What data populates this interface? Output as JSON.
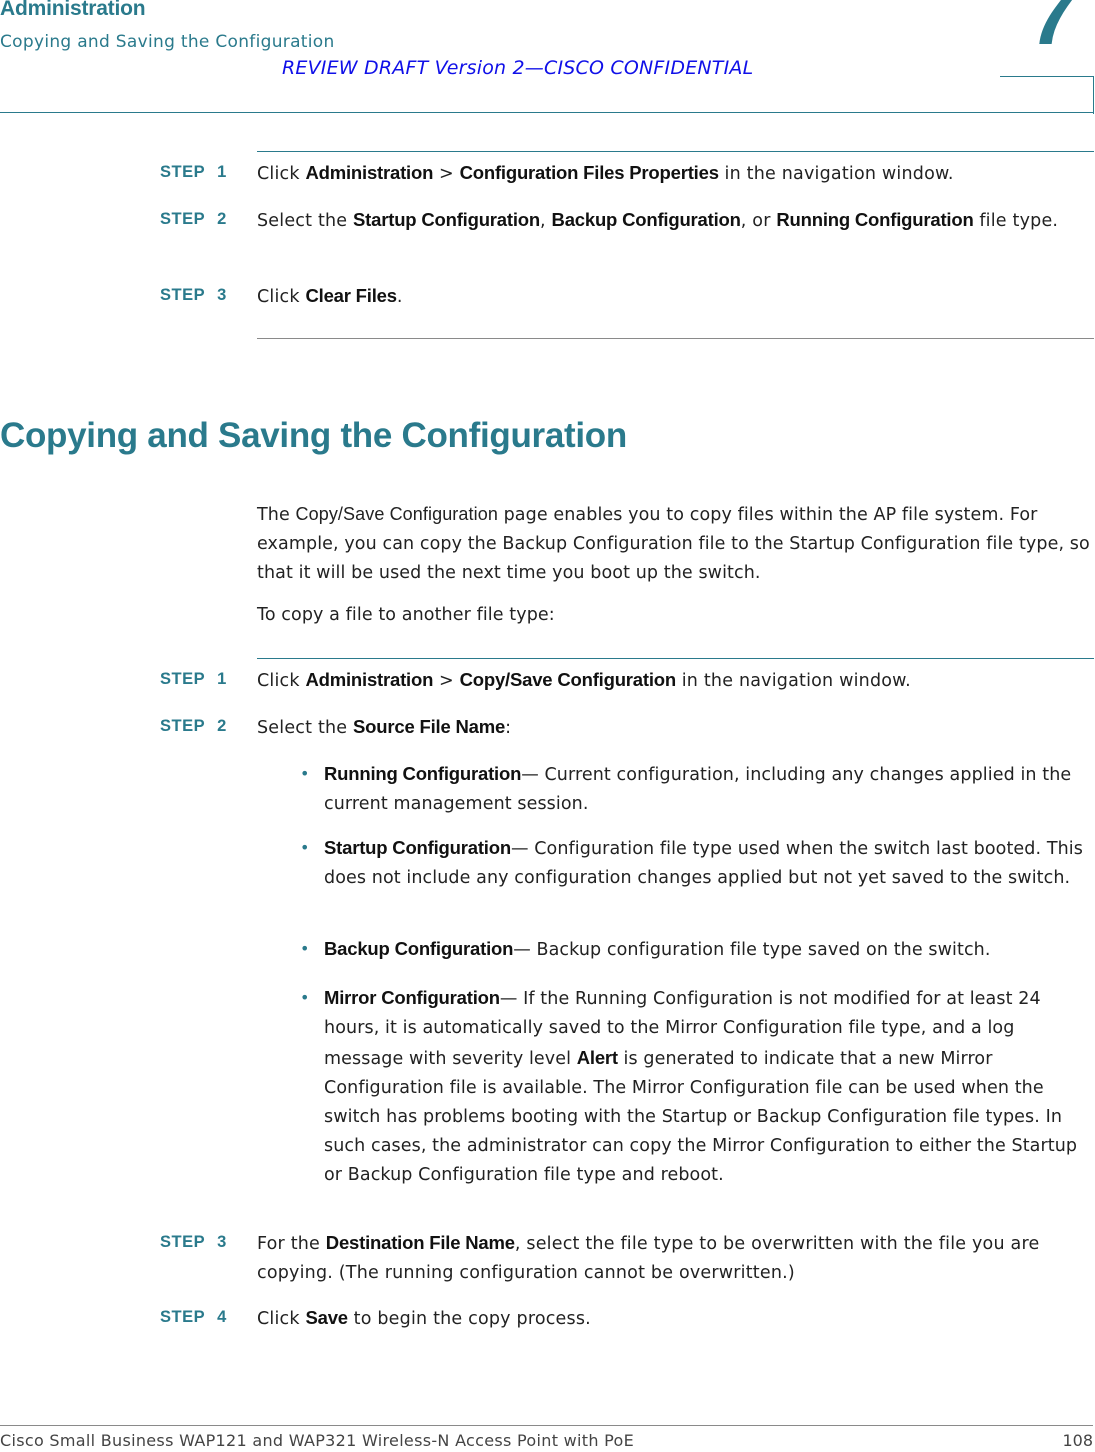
{
  "header": {
    "chapter_title": "Administration",
    "section_title": "Copying and Saving the Configuration",
    "review_notice": "REVIEW DRAFT  Version 2—CISCO CONFIDENTIAL",
    "chapter_number": "7"
  },
  "clear_steps": [
    {
      "label": "STEP",
      "number": "1",
      "parts": [
        {
          "t": "Click "
        },
        {
          "t": "Administration",
          "b": true
        },
        {
          "t": " > "
        },
        {
          "t": "Configuration Files Properties",
          "b": true
        },
        {
          "t": " in the navigation window."
        }
      ]
    },
    {
      "label": "STEP",
      "number": "2",
      "parts": [
        {
          "t": "Select the "
        },
        {
          "t": "Startup Configuration",
          "b": true
        },
        {
          "t": ", "
        },
        {
          "t": "Backup Configuration",
          "b": true
        },
        {
          "t": ", or "
        },
        {
          "t": "Running Configuration",
          "b": true
        },
        {
          "t": " file type."
        }
      ]
    },
    {
      "label": "STEP",
      "number": "3",
      "parts": [
        {
          "t": "Click "
        },
        {
          "t": "Clear Files",
          "b": true
        },
        {
          "t": "."
        }
      ]
    }
  ],
  "section": {
    "heading": "Copying and Saving the Configuration",
    "intro_parts": [
      {
        "t": "The "
      },
      {
        "t": "Copy/Save Configuration",
        "em": true
      },
      {
        "t": " page enables you to copy files within the AP file system. For example, you can copy the Backup Configuration file to the Startup Configuration file type, so that it will be used the next time you boot up the switch."
      }
    ],
    "lead_in": "To copy a file to another file type:"
  },
  "copy_steps": [
    {
      "label": "STEP",
      "number": "1",
      "parts": [
        {
          "t": "Click "
        },
        {
          "t": "Administration",
          "b": true
        },
        {
          "t": " > "
        },
        {
          "t": "Copy/Save Configuration",
          "b": true
        },
        {
          "t": " in the navigation window."
        }
      ]
    },
    {
      "label": "STEP",
      "number": "2",
      "parts": [
        {
          "t": "Select the "
        },
        {
          "t": "Source File Name",
          "b": true
        },
        {
          "t": ":"
        }
      ]
    },
    {
      "label": "STEP",
      "number": "3",
      "parts": [
        {
          "t": "For the "
        },
        {
          "t": "Destination File Name",
          "b": true
        },
        {
          "t": ", select the file type to be overwritten with the file you are copying. (The running configuration cannot be overwritten.)"
        }
      ]
    },
    {
      "label": "STEP",
      "number": "4",
      "parts": [
        {
          "t": "Click "
        },
        {
          "t": "Save",
          "b": true
        },
        {
          "t": " to begin the copy process."
        }
      ]
    }
  ],
  "source_options": [
    {
      "parts": [
        {
          "t": "Running Configuration",
          "b": true
        },
        {
          "t": "— Current configuration, including any changes applied in the current management session."
        }
      ]
    },
    {
      "parts": [
        {
          "t": "Startup Configuration",
          "b": true
        },
        {
          "t": "— Configuration file type used when the switch last booted. This does not include any configuration changes applied but not yet saved to the switch."
        }
      ]
    },
    {
      "parts": [
        {
          "t": "Backup Configuration",
          "b": true
        },
        {
          "t": "— Backup configuration file type saved on the switch."
        }
      ]
    },
    {
      "parts": [
        {
          "t": "Mirror Configuration",
          "b": true
        },
        {
          "t": "— If the Running Configuration is not modified for at least 24 hours, it is automatically saved to the Mirror Configuration file type, and a log message with severity level "
        },
        {
          "t": "Alert",
          "b": true
        },
        {
          "t": " is generated to indicate that a new Mirror Configuration file is available. The Mirror Configuration file can be used when the switch has problems booting with the Startup or Backup Configuration file types. In such cases, the administrator can copy the Mirror Configuration to either the Startup or Backup Configuration file type and reboot."
        }
      ]
    }
  ],
  "bullet_glyph": "•",
  "footer": {
    "product": "Cisco Small Business WAP121 and WAP321 Wireless-N Access Point with PoE",
    "page_number": "108"
  },
  "colors": {
    "accent_teal": "#2a7a8c",
    "review_blue": "#1010e8",
    "body_text": "#222222"
  }
}
